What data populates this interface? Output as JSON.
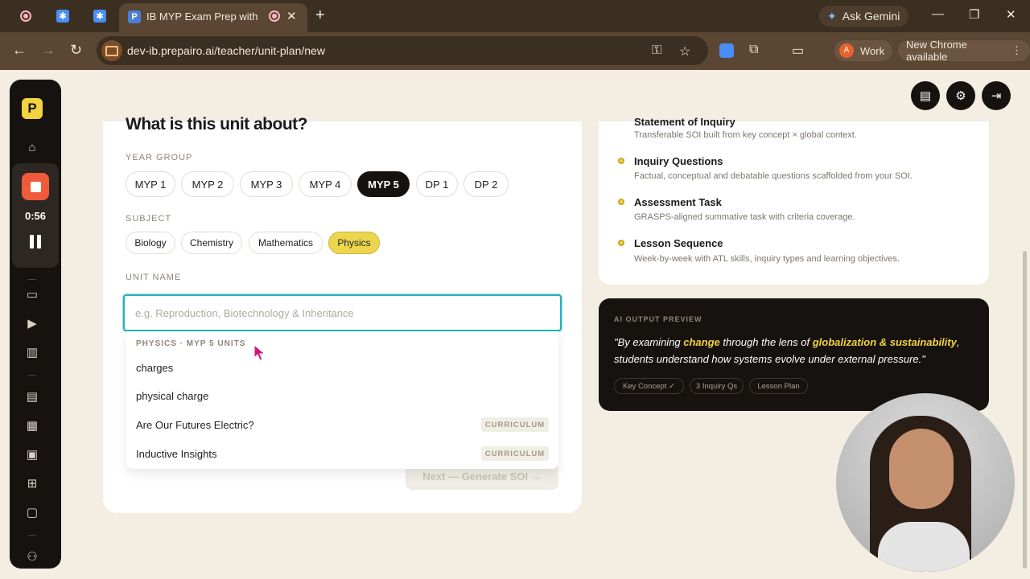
{
  "browser": {
    "active_tab_title": "IB MYP Exam Prep with AI |",
    "url": "dev-ib.prepairo.ai/teacher/unit-plan/new",
    "gemini_label": "Ask Gemini",
    "profile_initial": "A",
    "profile_label": "Work",
    "update_label": "New Chrome available"
  },
  "sidebar": {
    "logo": "P",
    "timer": "0:56"
  },
  "form": {
    "heading": "What is this unit about?",
    "year_group_label": "YEAR GROUP",
    "year_groups": [
      "MYP 1",
      "MYP 2",
      "MYP 3",
      "MYP 4",
      "MYP 5",
      "DP 1",
      "DP 2"
    ],
    "selected_year": "MYP 5",
    "subject_label": "SUBJECT",
    "subjects": [
      "Biology",
      "Chemistry",
      "Mathematics",
      "Physics"
    ],
    "selected_subject": "Physics",
    "unit_name_label": "UNIT NAME",
    "unit_name_placeholder": "e.g. Reproduction, Biotechnology & Inheritance",
    "unit_name_value": "",
    "next_button": "Next — Generate SOI →"
  },
  "dropdown": {
    "header": "PHYSICS · MYP 5 UNITS",
    "items": [
      {
        "label": "charges",
        "badge": ""
      },
      {
        "label": "physical charge",
        "badge": ""
      },
      {
        "label": "Are Our Futures Electric?",
        "badge": "CURRICULUM"
      },
      {
        "label": "Inductive Insights",
        "badge": "CURRICULUM"
      }
    ]
  },
  "outputs": [
    {
      "title": "Statement of Inquiry",
      "desc": "Transferable SOI built from key concept × global context."
    },
    {
      "title": "Inquiry Questions",
      "desc": "Factual, conceptual and debatable questions scaffolded from your SOI."
    },
    {
      "title": "Assessment Task",
      "desc": "GRASPS-aligned summative task with criteria coverage."
    },
    {
      "title": "Lesson Sequence",
      "desc": "Week-by-week with ATL skills, inquiry types and learning objectives."
    }
  ],
  "preview": {
    "label": "AI OUTPUT PREVIEW",
    "quote_part1": "\"By examining ",
    "quote_highlight1": "change",
    "quote_part2": " through the lens of ",
    "quote_highlight2": "globalization & sustainability",
    "quote_part3": ", students understand how systems evolve under external pressure.\"",
    "chips": [
      "Key Concept ✓",
      "3 Inquiry Qs",
      "Lesson Plan"
    ]
  },
  "colors": {
    "accent_yellow": "#f4d340",
    "dark": "#16120f",
    "focus_teal": "#28b0b8",
    "background": "#f3ede2"
  }
}
